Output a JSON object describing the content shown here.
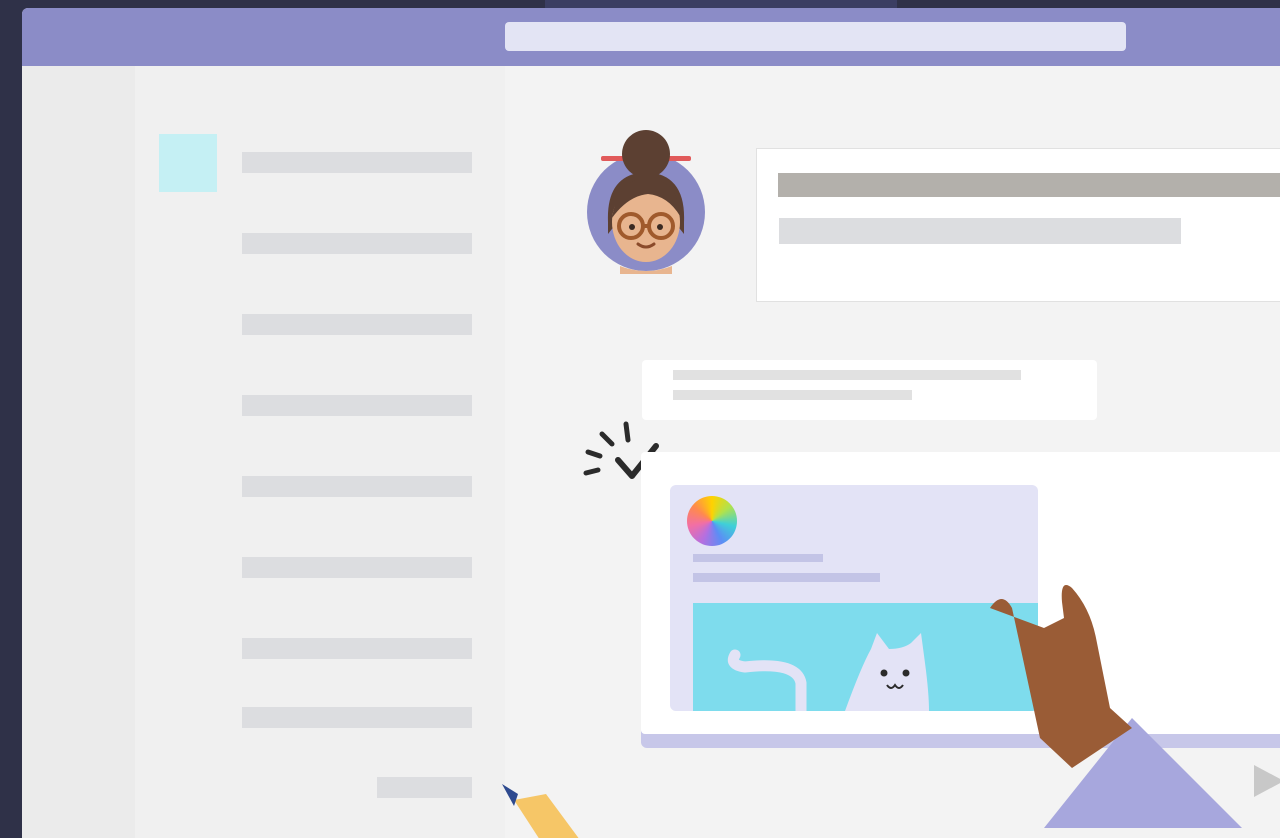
{
  "window": {
    "titlebar_color": "#8b8cc7"
  },
  "search": {
    "placeholder": "",
    "value": ""
  },
  "chat_list": {
    "item_count": 9
  },
  "colors": {
    "accent": "#8b8cc7",
    "search_fill": "#e3e4f4",
    "highlight": "#c5f0f4",
    "adaptive_card": "#e3e3f6",
    "sky": "#7edced"
  },
  "icons": [
    "avatar-illustration",
    "sparkle-check-icon",
    "color-wheel-icon",
    "cat-illustration",
    "send-icon",
    "hand-illustration",
    "pencil-illustration"
  ]
}
